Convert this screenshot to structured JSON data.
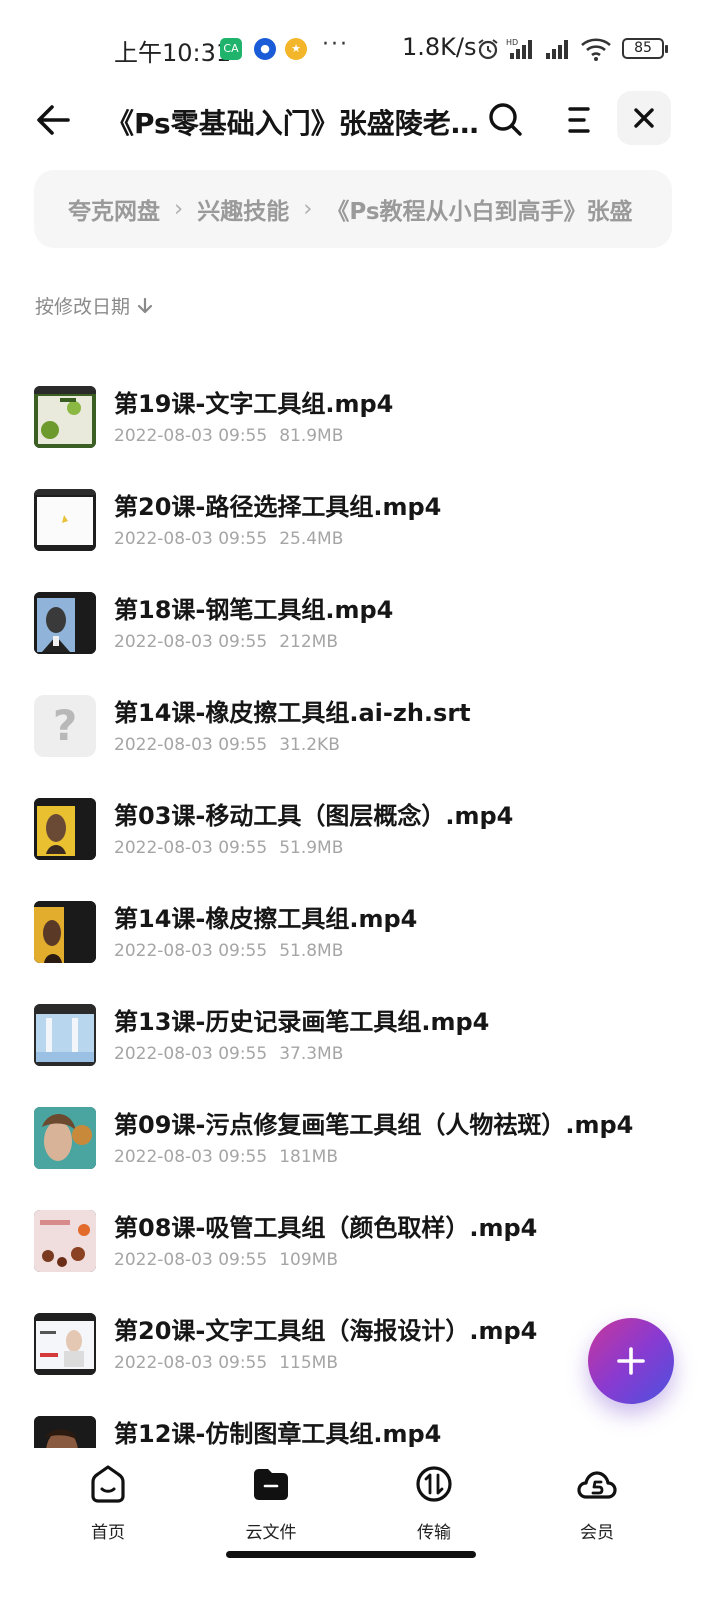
{
  "status_bar": {
    "time": "上午10:31",
    "app_badges": [
      "CA",
      "●",
      "★"
    ],
    "more": "···",
    "net_speed": "1.8K/s",
    "battery": "85",
    "icons": [
      "alarm-icon",
      "hd-signal-icon",
      "signal-icon",
      "wifi-icon",
      "battery-icon"
    ]
  },
  "header": {
    "title": "《Ps零基础入门》张盛陵老师…",
    "icons": {
      "back": "back-arrow-icon",
      "search": "search-icon",
      "menu": "menu-icon",
      "close": "close-icon"
    }
  },
  "breadcrumb": {
    "items": [
      "夸克网盘",
      "兴趣技能",
      "《Ps教程从小白到高手》张盛"
    ],
    "separator": "›"
  },
  "sort": {
    "label": "按修改日期",
    "icon": "arrow-down-icon"
  },
  "files": [
    {
      "name": "第19课-文字工具组.mp4",
      "date": "2022-08-03 09:55",
      "size": "81.9MB",
      "thumb": "video-green"
    },
    {
      "name": "第20课-路径选择工具组.mp4",
      "date": "2022-08-03 09:55",
      "size": "25.4MB",
      "thumb": "video-white"
    },
    {
      "name": "第18课-钢笔工具组.mp4",
      "date": "2022-08-03 09:55",
      "size": "212MB",
      "thumb": "video-blue"
    },
    {
      "name": "第14课-橡皮擦工具组.ai-zh.srt",
      "date": "2022-08-03 09:55",
      "size": "31.2KB",
      "thumb": "unknown"
    },
    {
      "name": "第03课-移动工具（图层概念）.mp4",
      "date": "2022-08-03 09:55",
      "size": "51.9MB",
      "thumb": "video-yellow"
    },
    {
      "name": "第14课-橡皮擦工具组.mp4",
      "date": "2022-08-03 09:55",
      "size": "51.8MB",
      "thumb": "video-gold"
    },
    {
      "name": "第13课-历史记录画笔工具组.mp4",
      "date": "2022-08-03 09:55",
      "size": "37.3MB",
      "thumb": "video-lightblue"
    },
    {
      "name": "第09课-污点修复画笔工具组（人物祛斑）.mp4",
      "date": "2022-08-03 09:55",
      "size": "181MB",
      "thumb": "video-teal"
    },
    {
      "name": "第08课-吸管工具组（颜色取样）.mp4",
      "date": "2022-08-03 09:55",
      "size": "109MB",
      "thumb": "video-pink"
    },
    {
      "name": "第20课-文字工具组（海报设计）.mp4",
      "date": "2022-08-03 09:55",
      "size": "115MB",
      "thumb": "video-poster"
    },
    {
      "name": "第12课-仿制图章工具组.mp4",
      "date": "",
      "size": "",
      "thumb": "video-dark"
    }
  ],
  "fab": {
    "label": "+",
    "icon": "plus-icon"
  },
  "bottom_nav": [
    {
      "label": "首页",
      "icon": "home-icon",
      "active": false
    },
    {
      "label": "云文件",
      "icon": "folder-icon",
      "active": true
    },
    {
      "label": "传输",
      "icon": "transfer-icon",
      "active": false
    },
    {
      "label": "会员",
      "icon": "vip-icon",
      "active": false
    }
  ]
}
